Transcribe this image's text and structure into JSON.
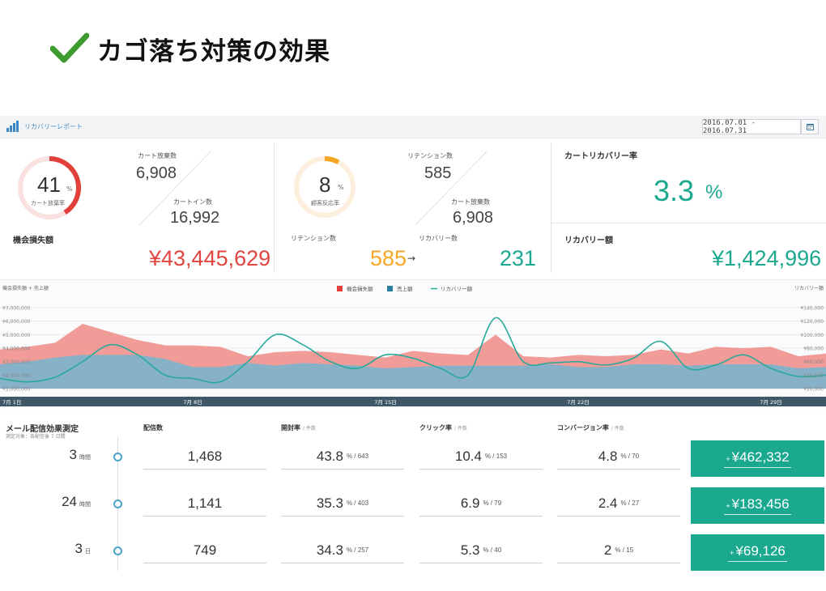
{
  "slide": {
    "title": "カゴ落ち対策の効果",
    "check_color": "#3e9b2f"
  },
  "header": {
    "report_title": "リカバリーレポート",
    "date_range": "2016.07.01 - 2016.07.31"
  },
  "cart_panel": {
    "gauge_value": "41",
    "gauge_unit": "%",
    "gauge_label": "カート放棄率",
    "gauge_fraction": 0.41,
    "abandon_label": "カート放棄数",
    "abandon_value": "6,908",
    "cartin_label": "カートイン数",
    "cartin_value": "16,992",
    "loss_label": "機会損失額",
    "loss_value": "¥43,445,629"
  },
  "retention_panel": {
    "gauge_value": "8",
    "gauge_unit": "%",
    "gauge_label": "顧客反応率",
    "gauge_fraction": 0.08,
    "retention_label": "リテンション数",
    "retention_value": "585",
    "abandon_label": "カート放棄数",
    "abandon_value": "6,908",
    "retention_label2": "リテンション数",
    "retention_value2": "585",
    "arrow": "→",
    "recovery_label": "リカバリー数",
    "recovery_value": "231"
  },
  "recovery_panel": {
    "rate_label": "カートリカバリー率",
    "rate_value": "3.3",
    "rate_unit": "%",
    "amount_label": "リカバリー額",
    "amount_value": "¥1,424,996"
  },
  "chart_data": {
    "type": "area",
    "left_axis_title": "機会損失額 + 売上額",
    "right_axis_title": "リカバリー額",
    "legend": [
      "機会損失額",
      "売上額",
      "リカバリー額"
    ],
    "legend_position": "top-center",
    "colors": {
      "loss": "#ee8b86",
      "sales": "#7fb2c9",
      "recovery": "#29a99a",
      "axis_band": "#3f5868"
    },
    "left_ticks": [
      "¥7,000,000",
      "¥6,000,000",
      "¥5,000,000",
      "¥4,000,000",
      "¥3,000,000",
      "¥2,000,000",
      "¥1,000,000"
    ],
    "right_ticks": [
      "¥140,000",
      "¥120,000",
      "¥100,000",
      "¥80,000",
      "¥60,000",
      "¥40,000",
      "¥20,000"
    ],
    "x_ticks": [
      "7月 1日",
      "7月 8日",
      "7月 15日",
      "7月 22日",
      "7月 29日"
    ],
    "x_tick_days": [
      1,
      8,
      15,
      22,
      29
    ],
    "days": [
      1,
      2,
      3,
      4,
      5,
      6,
      7,
      8,
      9,
      10,
      11,
      12,
      13,
      14,
      15,
      16,
      17,
      18,
      19,
      20,
      21,
      22,
      23,
      24,
      25,
      26,
      27,
      28,
      29,
      30,
      31
    ],
    "left_ylim": [
      1000000,
      7000000
    ],
    "right_ylim": [
      20000,
      140000
    ],
    "series": [
      {
        "name": "機会損失額",
        "axis": "left",
        "values": [
          3900000,
          4100000,
          4400000,
          5800000,
          5200000,
          4600000,
          4200000,
          4200000,
          4100000,
          3400000,
          3700000,
          3800000,
          3700000,
          3500000,
          3300000,
          3800000,
          3600000,
          3500000,
          5000000,
          3400000,
          3300000,
          3500000,
          3400000,
          3500000,
          3900000,
          3600000,
          4100000,
          4000000,
          4100000,
          3400000,
          3600000
        ]
      },
      {
        "name": "売上額",
        "axis": "left",
        "values": [
          2800000,
          3000000,
          3300000,
          3500000,
          3500000,
          3500000,
          3200000,
          2600000,
          2600000,
          2900000,
          2700000,
          2900000,
          2800000,
          2700000,
          2500000,
          2600000,
          2700000,
          2700000,
          2700000,
          2700000,
          2800000,
          2600000,
          2600000,
          2800000,
          2800000,
          2700000,
          2800000,
          2800000,
          2800000,
          2500000,
          2600000
        ]
      },
      {
        "name": "リカバリー額",
        "axis": "right",
        "values": [
          35000,
          30000,
          37000,
          60000,
          85000,
          70000,
          40000,
          35000,
          30000,
          60000,
          100000,
          85000,
          60000,
          50000,
          70000,
          65000,
          50000,
          40000,
          125000,
          60000,
          58000,
          60000,
          55000,
          65000,
          90000,
          50000,
          55000,
          70000,
          50000,
          38000,
          40000
        ]
      }
    ]
  },
  "mail": {
    "title": "メール配信効果測定",
    "subtitle": "測定対象：各配信後 7 日間",
    "headers": {
      "delivered": "配信数",
      "open": "開封率",
      "open_sub": "/ 件数",
      "click": "クリック率",
      "click_sub": "/ 件数",
      "conv": "コンバージョン率",
      "conv_sub": "/ 件数"
    },
    "rows": [
      {
        "time": "3",
        "unit": "時間",
        "delivered": "1,468",
        "open": "43.8",
        "open_sub": "% / 643",
        "click": "10.4",
        "click_sub": "% / 153",
        "conv": "4.8",
        "conv_sub": "% / 70",
        "plus": "+",
        "amount": "¥462,332"
      },
      {
        "time": "24",
        "unit": "時間",
        "delivered": "1,141",
        "open": "35.3",
        "open_sub": "% / 403",
        "click": "6.9",
        "click_sub": "% / 79",
        "conv": "2.4",
        "conv_sub": "% / 27",
        "plus": "+",
        "amount": "¥183,456"
      },
      {
        "time": "3",
        "unit": "日",
        "delivered": "749",
        "open": "34.3",
        "open_sub": "% / 257",
        "click": "5.3",
        "click_sub": "% / 40",
        "conv": "2",
        "conv_sub": "% / 15",
        "plus": "+",
        "amount": "¥69,126"
      }
    ]
  }
}
